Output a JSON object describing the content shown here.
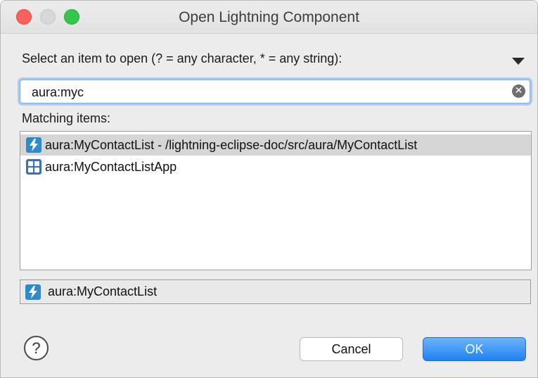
{
  "window": {
    "title": "Open Lightning Component"
  },
  "prompt": {
    "label": "Select an item to open (? = any character, * = any string):"
  },
  "search": {
    "value": "aura:myc"
  },
  "matching": {
    "label": "Matching items:",
    "items": [
      {
        "label": "aura:MyContactList - /lightning-eclipse-doc/src/aura/MyContactList",
        "icon": "lightning-bolt-icon",
        "selected": true
      },
      {
        "label": "aura:MyContactListApp",
        "icon": "app-grid-icon",
        "selected": false
      }
    ]
  },
  "detail": {
    "label": "aura:MyContactList",
    "icon": "lightning-bolt-icon"
  },
  "buttons": {
    "help_label": "?",
    "cancel_label": "Cancel",
    "ok_label": "OK"
  },
  "colors": {
    "accent": "#1f82f1",
    "component_icon": "#2f8ac8",
    "app_icon": "#3b73b2"
  }
}
